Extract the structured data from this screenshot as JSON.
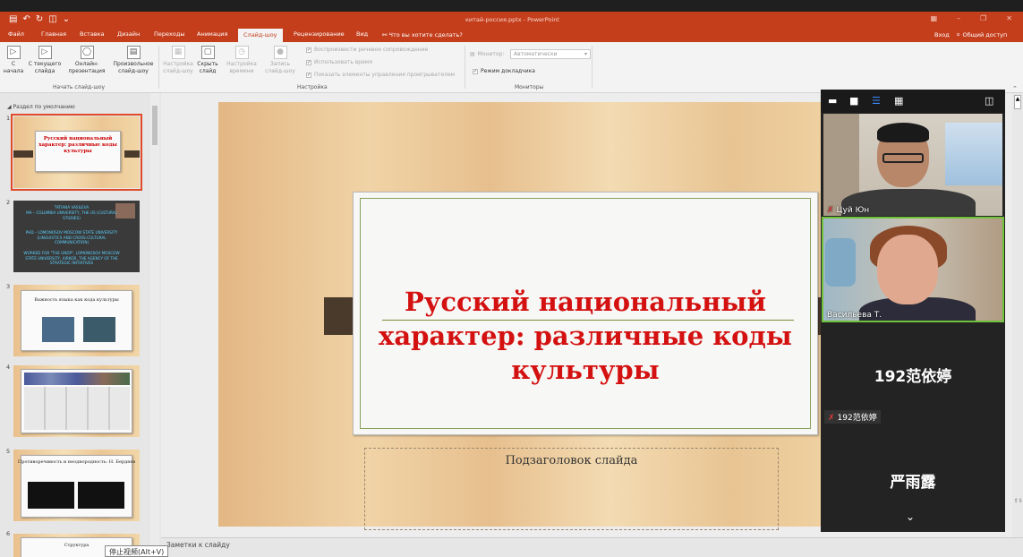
{
  "app": {
    "window_title": "китай-россия.pptx - PowerPoint",
    "qat_icons": [
      "save-icon",
      "undo-icon",
      "redo-icon",
      "present-icon",
      "customize-icon"
    ]
  },
  "tabs": [
    "Файл",
    "Главная",
    "Вставка",
    "Дизайн",
    "Переходы",
    "Анимация",
    "Слайд-шоу",
    "Рецензирование",
    "Вид"
  ],
  "active_tab": "Слайд-шоу",
  "tellme": "Что вы хотите сделать?",
  "signin": "Вход",
  "share": "Общий доступ",
  "ribbon": {
    "start": {
      "group_label": "Начать слайд-шоу",
      "from_beginning": "С начала",
      "from_current": "С текущего слайда",
      "online": "Онлайн-презентация",
      "custom": "Произвольное слайд-шоу"
    },
    "setup": {
      "group_label": "Настройка",
      "setup_show": "Настройка слайд-шоу",
      "hide_slide": "Скрыть слайд",
      "rehearse": "Настройка времени",
      "record": "Запись слайд-шоу",
      "play_narrations": "Воспроизвести речевое сопровождение",
      "use_timings": "Использовать время",
      "show_media": "Показать элементы управления проигрывателем"
    },
    "monitors": {
      "group_label": "Мониторы",
      "monitor_label": "Монитор:",
      "monitor_value": "Автоматически",
      "presenter_view": "Режим докладчика"
    }
  },
  "left_pane": {
    "section": "Раздел по умолчанию",
    "slides": [
      {
        "num": "1",
        "title": "Русский национальный характер: различные коды культуры"
      },
      {
        "num": "2",
        "lines": [
          "TATIANA VASILEVA",
          "MA – COLUMBIA UNIVERSITY, THE US (CULTURAL STUDIES)",
          "PHD – LOMONOSOV MOSCOW STATE UNIVERSITY (LINGUISTICS AND CROSS-CULTURAL COMMUNICATION)",
          "WORKED FOR \"THE UNDP\", LOMONOSOV MOSCOW STATE UNIVERSITY, AIRKOR, THE AGENCY OF THE STRATEGIC INITIATIVES"
        ]
      },
      {
        "num": "3",
        "title": "Важность языка как кода культуры"
      },
      {
        "num": "4"
      },
      {
        "num": "5",
        "title": "Противоречивость и неоднородность: Н. Бердяев"
      },
      {
        "num": "6",
        "title": "Структура"
      }
    ]
  },
  "slide": {
    "title": "Русский национальный характер: различные коды культуры",
    "subtitle": "Подзаголовок слайда"
  },
  "notes_placeholder": "Заметки к слайду",
  "tooltip": "停止视频(Alt+V)",
  "zoom": {
    "participants": [
      {
        "name": "Цуй Юн",
        "muted": true
      },
      {
        "name": "Васильева Т.",
        "muted": false,
        "active": true
      },
      {
        "name": "192范依婷",
        "muted": true
      },
      {
        "name": "严雨露",
        "muted": true
      }
    ]
  }
}
